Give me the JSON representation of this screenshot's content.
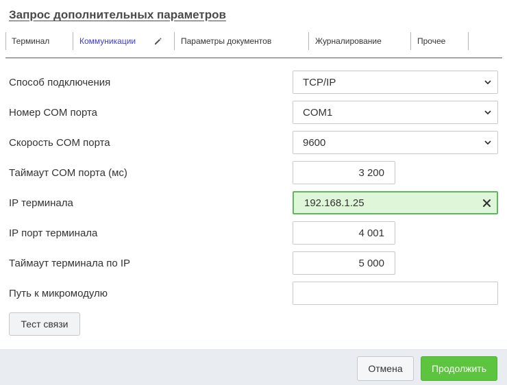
{
  "dialog": {
    "title": "Запрос дополнительных параметров"
  },
  "tabs": [
    {
      "label": "Терминал"
    },
    {
      "label": "Коммуникации",
      "active": true,
      "icon": "pencil-icon"
    },
    {
      "label": "Параметры документов"
    },
    {
      "label": "Журналирование"
    },
    {
      "label": "Прочее"
    }
  ],
  "fields": {
    "connection_method": {
      "label": "Способ подключения",
      "value": "TCP/IP"
    },
    "com_port": {
      "label": "Номер COM порта",
      "value": "COM1"
    },
    "com_speed": {
      "label": "Скорость COM порта",
      "value": "9600"
    },
    "com_timeout": {
      "label": "Таймаут COM порта (мс)",
      "value": "3 200"
    },
    "terminal_ip": {
      "label": "IP терминала",
      "value": "192.168.1.25",
      "clear_icon": "close-icon"
    },
    "terminal_port": {
      "label": "IP порт терминала",
      "value": "4 001"
    },
    "ip_timeout": {
      "label": "Таймаут терминала по IP",
      "value": "5 000"
    },
    "micromodule_path": {
      "label": "Путь к микромодулю",
      "value": ""
    }
  },
  "buttons": {
    "test": "Тест связи",
    "cancel": "Отмена",
    "continue": "Продолжить"
  },
  "colors": {
    "accent_green": "#5cc43e",
    "active_tab": "#3a3acf",
    "valid_field_bg": "#dff6d9",
    "valid_field_border": "#5cb85c"
  }
}
